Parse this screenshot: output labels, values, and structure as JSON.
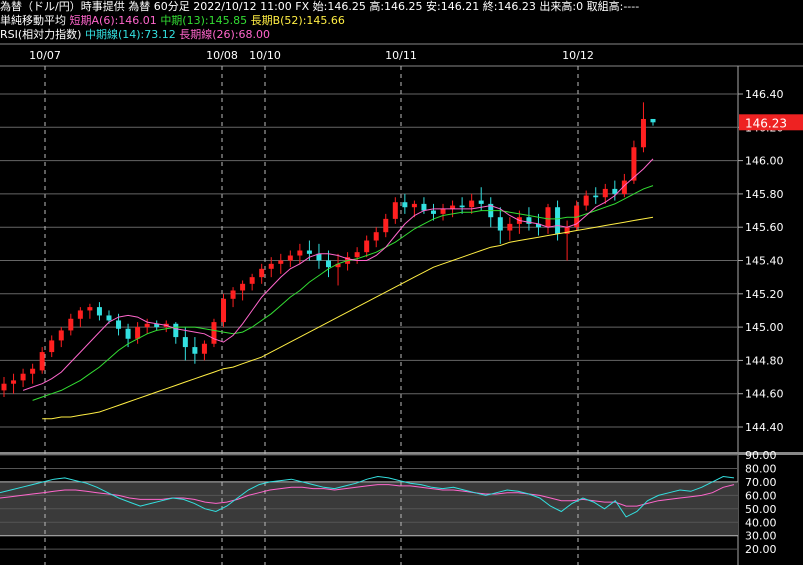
{
  "header": {
    "title": "為替（ドル/円）時事提供 為替 60分足",
    "quote": "2022/10/12 11:00 FX 始:146.25 高:146.25 安:146.21 終:146.23 出来高:0 取組高:----",
    "ma_label": "単純移動平均",
    "ma_short": "短期A(6):146.01",
    "ma_mid": "中期(13):145.85",
    "ma_long": "長期B(52):145.66",
    "rsi_label": "RSI(相対力指数)",
    "rsi_mid": "中期線(14):73.12",
    "rsi_long": "長期線(26):68.00"
  },
  "date_labels": [
    "10/07",
    "10/08",
    "10/10",
    "10/11",
    "10/12"
  ],
  "price_ticks": [
    "146.40",
    "146.20",
    "146.00",
    "145.80",
    "145.60",
    "145.40",
    "145.20",
    "145.00",
    "144.80",
    "144.60",
    "144.40"
  ],
  "current_price": "146.23",
  "rsi_ticks": [
    "90.00",
    "80.00",
    "70.00",
    "60.00",
    "50.00",
    "40.00",
    "30.00",
    "20.00"
  ],
  "colors": {
    "up": "#ff2020",
    "down": "#33e0e0",
    "ma_short": "#ff66cc",
    "ma_mid": "#33dd33",
    "ma_long": "#ffee44",
    "price_tag": "#ee2222"
  },
  "chart_data": [
    {
      "type": "candlestick",
      "title": "為替（ドル/円）時事提供 為替 60分足",
      "ylim": [
        144.3,
        146.5
      ],
      "x_labels": [
        "10/07",
        "10/08",
        "10/10",
        "10/11",
        "10/12"
      ],
      "candles": [
        {
          "o": 144.62,
          "h": 144.7,
          "l": 144.58,
          "c": 144.66
        },
        {
          "o": 144.66,
          "h": 144.72,
          "l": 144.6,
          "c": 144.68
        },
        {
          "o": 144.68,
          "h": 144.75,
          "l": 144.64,
          "c": 144.72
        },
        {
          "o": 144.72,
          "h": 144.78,
          "l": 144.66,
          "c": 144.75
        },
        {
          "o": 144.74,
          "h": 144.88,
          "l": 144.72,
          "c": 144.85
        },
        {
          "o": 144.85,
          "h": 144.95,
          "l": 144.82,
          "c": 144.92
        },
        {
          "o": 144.92,
          "h": 145.0,
          "l": 144.88,
          "c": 144.98
        },
        {
          "o": 144.98,
          "h": 145.08,
          "l": 144.95,
          "c": 145.05
        },
        {
          "o": 145.05,
          "h": 145.12,
          "l": 145.0,
          "c": 145.1
        },
        {
          "o": 145.1,
          "h": 145.14,
          "l": 145.05,
          "c": 145.12
        },
        {
          "o": 145.12,
          "h": 145.15,
          "l": 145.04,
          "c": 145.07
        },
        {
          "o": 145.07,
          "h": 145.1,
          "l": 145.02,
          "c": 145.04
        },
        {
          "o": 145.04,
          "h": 145.08,
          "l": 144.95,
          "c": 144.99
        },
        {
          "o": 144.99,
          "h": 145.02,
          "l": 144.88,
          "c": 144.93
        },
        {
          "o": 144.93,
          "h": 145.03,
          "l": 144.9,
          "c": 145.0
        },
        {
          "o": 145.0,
          "h": 145.05,
          "l": 144.96,
          "c": 145.02
        },
        {
          "o": 145.02,
          "h": 145.04,
          "l": 144.98,
          "c": 145.0
        },
        {
          "o": 145.0,
          "h": 145.04,
          "l": 144.97,
          "c": 145.02
        },
        {
          "o": 145.02,
          "h": 145.03,
          "l": 144.9,
          "c": 144.94
        },
        {
          "o": 144.94,
          "h": 145.0,
          "l": 144.8,
          "c": 144.88
        },
        {
          "o": 144.88,
          "h": 144.94,
          "l": 144.78,
          "c": 144.84
        },
        {
          "o": 144.84,
          "h": 144.92,
          "l": 144.8,
          "c": 144.9
        },
        {
          "o": 144.9,
          "h": 145.05,
          "l": 144.88,
          "c": 145.03
        },
        {
          "o": 145.03,
          "h": 145.2,
          "l": 145.0,
          "c": 145.17
        },
        {
          "o": 145.17,
          "h": 145.24,
          "l": 145.12,
          "c": 145.22
        },
        {
          "o": 145.22,
          "h": 145.28,
          "l": 145.16,
          "c": 145.26
        },
        {
          "o": 145.26,
          "h": 145.32,
          "l": 145.22,
          "c": 145.3
        },
        {
          "o": 145.3,
          "h": 145.38,
          "l": 145.26,
          "c": 145.35
        },
        {
          "o": 145.35,
          "h": 145.42,
          "l": 145.3,
          "c": 145.38
        },
        {
          "o": 145.38,
          "h": 145.44,
          "l": 145.32,
          "c": 145.4
        },
        {
          "o": 145.4,
          "h": 145.46,
          "l": 145.36,
          "c": 145.43
        },
        {
          "o": 145.43,
          "h": 145.5,
          "l": 145.38,
          "c": 145.46
        },
        {
          "o": 145.46,
          "h": 145.52,
          "l": 145.4,
          "c": 145.44
        },
        {
          "o": 145.44,
          "h": 145.5,
          "l": 145.35,
          "c": 145.4
        },
        {
          "o": 145.4,
          "h": 145.46,
          "l": 145.3,
          "c": 145.36
        },
        {
          "o": 145.36,
          "h": 145.44,
          "l": 145.25,
          "c": 145.38
        },
        {
          "o": 145.38,
          "h": 145.45,
          "l": 145.34,
          "c": 145.42
        },
        {
          "o": 145.42,
          "h": 145.48,
          "l": 145.38,
          "c": 145.45
        },
        {
          "o": 145.45,
          "h": 145.55,
          "l": 145.42,
          "c": 145.52
        },
        {
          "o": 145.52,
          "h": 145.6,
          "l": 145.48,
          "c": 145.57
        },
        {
          "o": 145.57,
          "h": 145.68,
          "l": 145.54,
          "c": 145.65
        },
        {
          "o": 145.65,
          "h": 145.78,
          "l": 145.62,
          "c": 145.75
        },
        {
          "o": 145.75,
          "h": 145.8,
          "l": 145.68,
          "c": 145.72
        },
        {
          "o": 145.72,
          "h": 145.76,
          "l": 145.66,
          "c": 145.74
        },
        {
          "o": 145.74,
          "h": 145.78,
          "l": 145.68,
          "c": 145.7
        },
        {
          "o": 145.7,
          "h": 145.74,
          "l": 145.64,
          "c": 145.68
        },
        {
          "o": 145.68,
          "h": 145.74,
          "l": 145.64,
          "c": 145.71
        },
        {
          "o": 145.71,
          "h": 145.76,
          "l": 145.66,
          "c": 145.73
        },
        {
          "o": 145.73,
          "h": 145.78,
          "l": 145.68,
          "c": 145.72
        },
        {
          "o": 145.72,
          "h": 145.8,
          "l": 145.68,
          "c": 145.76
        },
        {
          "o": 145.76,
          "h": 145.84,
          "l": 145.7,
          "c": 145.74
        },
        {
          "o": 145.74,
          "h": 145.78,
          "l": 145.6,
          "c": 145.66
        },
        {
          "o": 145.66,
          "h": 145.72,
          "l": 145.5,
          "c": 145.58
        },
        {
          "o": 145.58,
          "h": 145.66,
          "l": 145.52,
          "c": 145.62
        },
        {
          "o": 145.62,
          "h": 145.7,
          "l": 145.56,
          "c": 145.66
        },
        {
          "o": 145.66,
          "h": 145.72,
          "l": 145.58,
          "c": 145.62
        },
        {
          "o": 145.62,
          "h": 145.68,
          "l": 145.55,
          "c": 145.6
        },
        {
          "o": 145.6,
          "h": 145.74,
          "l": 145.56,
          "c": 145.72
        },
        {
          "o": 145.72,
          "h": 145.76,
          "l": 145.52,
          "c": 145.56
        },
        {
          "o": 145.56,
          "h": 145.64,
          "l": 145.4,
          "c": 145.6
        },
        {
          "o": 145.6,
          "h": 145.76,
          "l": 145.58,
          "c": 145.73
        },
        {
          "o": 145.73,
          "h": 145.82,
          "l": 145.7,
          "c": 145.79
        },
        {
          "o": 145.79,
          "h": 145.84,
          "l": 145.74,
          "c": 145.78
        },
        {
          "o": 145.78,
          "h": 145.86,
          "l": 145.74,
          "c": 145.83
        },
        {
          "o": 145.83,
          "h": 145.88,
          "l": 145.76,
          "c": 145.8
        },
        {
          "o": 145.8,
          "h": 145.92,
          "l": 145.78,
          "c": 145.88
        },
        {
          "o": 145.88,
          "h": 146.12,
          "l": 145.86,
          "c": 146.08
        },
        {
          "o": 146.08,
          "h": 146.35,
          "l": 146.05,
          "c": 146.25
        },
        {
          "o": 146.25,
          "h": 146.25,
          "l": 146.21,
          "c": 146.23
        }
      ],
      "ma_short": [
        144.62,
        144.64,
        144.66,
        144.69,
        144.73,
        144.79,
        144.85,
        144.91,
        144.97,
        145.03,
        145.06,
        145.07,
        145.06,
        145.03,
        145.02,
        145.01,
        144.99,
        144.98,
        144.97,
        144.96,
        144.93,
        144.91,
        144.95,
        145.02,
        145.1,
        145.18,
        145.24,
        145.3,
        145.35,
        145.38,
        145.42,
        145.44,
        145.44,
        145.43,
        145.41,
        145.4,
        145.4,
        145.43,
        145.48,
        145.55,
        145.62,
        145.67,
        145.7,
        145.71,
        145.71,
        145.71,
        145.71,
        145.71,
        145.72,
        145.73,
        145.71,
        145.67,
        145.64,
        145.63,
        145.62,
        145.6,
        145.61,
        145.6,
        145.62,
        145.67,
        145.72,
        145.75,
        145.79,
        145.85,
        145.9,
        145.95,
        146.01
      ],
      "ma_mid": [
        144.56,
        144.58,
        144.6,
        144.62,
        144.65,
        144.68,
        144.72,
        144.76,
        144.81,
        144.86,
        144.9,
        144.93,
        144.96,
        144.98,
        144.99,
        145.0,
        145.0,
        145.0,
        144.99,
        144.98,
        144.97,
        144.96,
        144.97,
        145.0,
        145.04,
        145.08,
        145.13,
        145.18,
        145.22,
        145.27,
        145.31,
        145.35,
        145.38,
        145.4,
        145.41,
        145.43,
        145.45,
        145.48,
        145.51,
        145.55,
        145.59,
        145.62,
        145.65,
        145.67,
        145.68,
        145.69,
        145.69,
        145.7,
        145.7,
        145.7,
        145.69,
        145.68,
        145.67,
        145.66,
        145.65,
        145.65,
        145.66,
        145.66,
        145.68,
        145.7,
        145.72,
        145.74,
        145.77,
        145.8,
        145.83,
        145.85
      ],
      "ma_long": [
        144.45,
        144.45,
        144.46,
        144.46,
        144.47,
        144.48,
        144.49,
        144.51,
        144.53,
        144.55,
        144.57,
        144.59,
        144.61,
        144.63,
        144.65,
        144.67,
        144.69,
        144.71,
        144.73,
        144.75,
        144.76,
        144.78,
        144.8,
        144.82,
        144.85,
        144.88,
        144.91,
        144.94,
        144.97,
        145.0,
        145.03,
        145.06,
        145.09,
        145.12,
        145.15,
        145.18,
        145.21,
        145.24,
        145.27,
        145.3,
        145.33,
        145.36,
        145.38,
        145.4,
        145.42,
        145.44,
        145.46,
        145.48,
        145.49,
        145.51,
        145.52,
        145.53,
        145.54,
        145.55,
        145.56,
        145.57,
        145.58,
        145.59,
        145.6,
        145.61,
        145.62,
        145.63,
        145.64,
        145.65,
        145.66
      ]
    },
    {
      "type": "line",
      "title": "RSI(相対力指数)",
      "ylim": [
        20,
        90
      ],
      "series": [
        {
          "name": "中期線(14)",
          "values": [
            62,
            64,
            66,
            68,
            70,
            72,
            73,
            71,
            69,
            66,
            62,
            58,
            55,
            52,
            54,
            56,
            58,
            57,
            54,
            50,
            48,
            52,
            58,
            64,
            68,
            70,
            71,
            72,
            70,
            68,
            66,
            65,
            67,
            69,
            72,
            74,
            73,
            71,
            69,
            68,
            66,
            65,
            66,
            64,
            62,
            60,
            62,
            64,
            63,
            61,
            58,
            52,
            48,
            54,
            58,
            55,
            50,
            56,
            44,
            48,
            56,
            60,
            62,
            64,
            63,
            66,
            70,
            74,
            73
          ]
        },
        {
          "name": "長期線(26)",
          "values": [
            58,
            59,
            60,
            61,
            62,
            63,
            64,
            64,
            63,
            62,
            61,
            60,
            58,
            57,
            57,
            57,
            58,
            58,
            57,
            55,
            54,
            55,
            57,
            60,
            62,
            64,
            65,
            66,
            66,
            65,
            65,
            64,
            65,
            66,
            67,
            68,
            68,
            67,
            67,
            66,
            65,
            64,
            64,
            63,
            62,
            61,
            61,
            62,
            62,
            61,
            60,
            58,
            56,
            56,
            57,
            56,
            55,
            55,
            52,
            52,
            54,
            56,
            57,
            58,
            59,
            60,
            62,
            66,
            68
          ]
        }
      ]
    }
  ]
}
